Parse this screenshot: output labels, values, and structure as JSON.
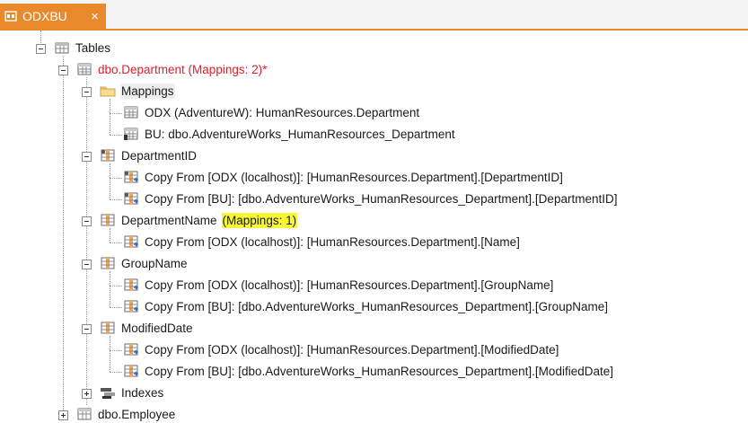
{
  "tab": {
    "title": "ODXBU",
    "close_glyph": "×"
  },
  "tree": {
    "tables_label": "Tables",
    "department": {
      "label": "dbo.Department (Mappings: 2)*"
    },
    "mappings": {
      "label": "Mappings",
      "items": [
        "ODX (AdventureW): HumanResources.Department",
        "BU: dbo.AdventureWorks_HumanResources_Department"
      ]
    },
    "columns": [
      {
        "name": "DepartmentID",
        "suffix": "",
        "copies": [
          "Copy From [ODX (localhost)]: [HumanResources.Department].[DepartmentID]",
          "Copy From [BU]: [dbo.AdventureWorks_HumanResources_Department].[DepartmentID]"
        ]
      },
      {
        "name": "DepartmentName",
        "suffix": "(Mappings: 1)",
        "copies": [
          "Copy From [ODX (localhost)]: [HumanResources.Department].[Name]"
        ]
      },
      {
        "name": "GroupName",
        "suffix": "",
        "copies": [
          "Copy From [ODX (localhost)]: [HumanResources.Department].[GroupName]",
          "Copy From [BU]: [dbo.AdventureWorks_HumanResources_Department].[GroupName]"
        ]
      },
      {
        "name": "ModifiedDate",
        "suffix": "",
        "copies": [
          "Copy From [ODX (localhost)]: [HumanResources.Department].[ModifiedDate]",
          "Copy From [BU]: [dbo.AdventureWorks_HumanResources_Department].[ModifiedDate]"
        ]
      }
    ],
    "indexes_label": "Indexes",
    "next_table_label": "dbo.Employee"
  },
  "colors": {
    "accent": "#e88a2c",
    "modified_red": "#e0202a",
    "highlight": "#f7f735"
  }
}
